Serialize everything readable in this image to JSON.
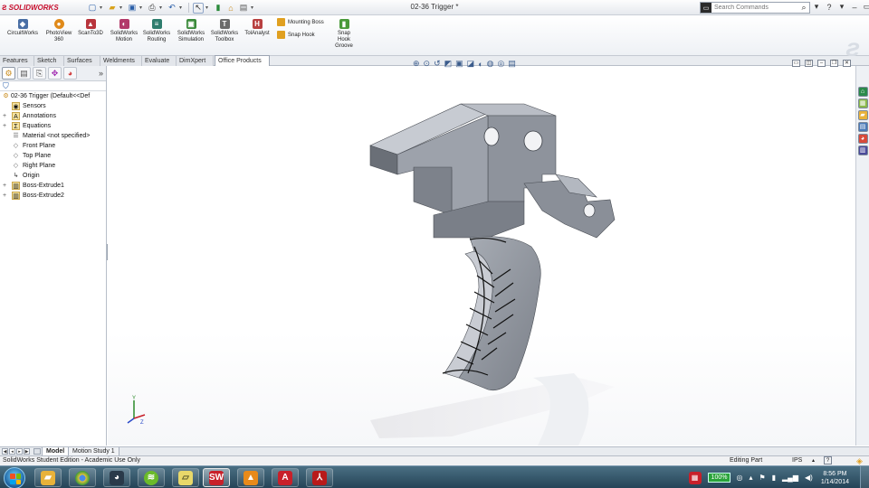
{
  "app": {
    "brand": "SOLIDWORKS",
    "document_title": "02-36 Trigger *"
  },
  "search": {
    "placeholder": "Search Commands"
  },
  "command_manager": {
    "buttons": [
      {
        "label": "CircuitWorks",
        "icon": "circuitworks-icon",
        "color": "#4a6fa5"
      },
      {
        "label": "PhotoView 360",
        "icon": "photoview-icon",
        "color": "#e08a1a"
      },
      {
        "label": "ScanTo3D",
        "icon": "scanto3d-icon",
        "color": "#b8343c"
      },
      {
        "label": "SolidWorks Motion",
        "icon": "motion-icon",
        "color": "#b23a6a"
      },
      {
        "label": "SolidWorks Routing",
        "icon": "routing-icon",
        "color": "#2e7d6e"
      },
      {
        "label": "SolidWorks Simulation",
        "icon": "simulation-icon",
        "color": "#3a8a3a"
      },
      {
        "label": "SolidWorks Toolbox",
        "icon": "toolbox-icon",
        "color": "#6b6b6b"
      },
      {
        "label": "TolAnalyst",
        "icon": "tolanalyst-icon",
        "color": "#b84040"
      },
      {
        "label": "Snap Hook Groove",
        "icon": "snap-hook-groove-icon",
        "color": "#4a9a3a"
      }
    ],
    "small_buttons": [
      {
        "label": "Mounting Boss",
        "icon": "mounting-boss-icon"
      },
      {
        "label": "Snap Hook",
        "icon": "snap-hook-icon"
      }
    ]
  },
  "tabs": [
    {
      "label": "Features"
    },
    {
      "label": "Sketch"
    },
    {
      "label": "Surfaces"
    },
    {
      "label": "Weldments"
    },
    {
      "label": "Evaluate"
    },
    {
      "label": "DimXpert"
    },
    {
      "label": "Office Products",
      "active": true
    }
  ],
  "feature_tree": {
    "root": "02-36 Trigger (Default<<Def",
    "items": [
      {
        "label": "Sensors",
        "icon": "sensor-icon",
        "expandable": false
      },
      {
        "label": "Annotations",
        "icon": "annotations-icon",
        "expandable": true
      },
      {
        "label": "Equations",
        "icon": "equations-icon",
        "expandable": true
      },
      {
        "label": "Material <not specified>",
        "icon": "material-icon",
        "expandable": false
      },
      {
        "label": "Front Plane",
        "icon": "plane-icon",
        "expandable": false
      },
      {
        "label": "Top Plane",
        "icon": "plane-icon",
        "expandable": false
      },
      {
        "label": "Right Plane",
        "icon": "plane-icon",
        "expandable": false
      },
      {
        "label": "Origin",
        "icon": "origin-icon",
        "expandable": false
      },
      {
        "label": "Boss-Extrude1",
        "icon": "boss-extrude-icon",
        "expandable": true
      },
      {
        "label": "Boss-Extrude2",
        "icon": "boss-extrude-icon",
        "expandable": true
      }
    ]
  },
  "bottom_tabs": [
    {
      "label": "Model",
      "active": true
    },
    {
      "label": "Motion Study 1",
      "active": false
    }
  ],
  "status_bar": {
    "left": "SolidWorks Student Edition - Academic Use Only",
    "mode": "Editing Part",
    "units": "IPS",
    "help": "?"
  },
  "taskbar": {
    "battery": "100%",
    "time": "8:56 PM",
    "date": "1/14/2014",
    "apps": [
      {
        "icon": "file-explorer-icon",
        "color": "#e8b23a"
      },
      {
        "icon": "chrome-icon",
        "color": "#3a9a3a"
      },
      {
        "icon": "solidworks-eye-icon",
        "color": "#2a3a4a"
      },
      {
        "icon": "spotify-icon",
        "color": "#6aba2a"
      },
      {
        "icon": "sticky-notes-icon",
        "color": "#e8d86a"
      },
      {
        "icon": "solidworks-taskbar-icon",
        "color": "#c8202a"
      },
      {
        "icon": "vlc-icon",
        "color": "#e88a1a"
      },
      {
        "icon": "autodesk-icon",
        "color": "#c8202a"
      },
      {
        "icon": "acrobat-icon",
        "color": "#b81a1a"
      }
    ]
  },
  "colors": {
    "part_face_light": "#c7cbd2",
    "part_face_mid": "#8e939c",
    "part_face_dark": "#5f646c",
    "sketch_lines": "#111111",
    "accent_red": "#c8102e"
  }
}
